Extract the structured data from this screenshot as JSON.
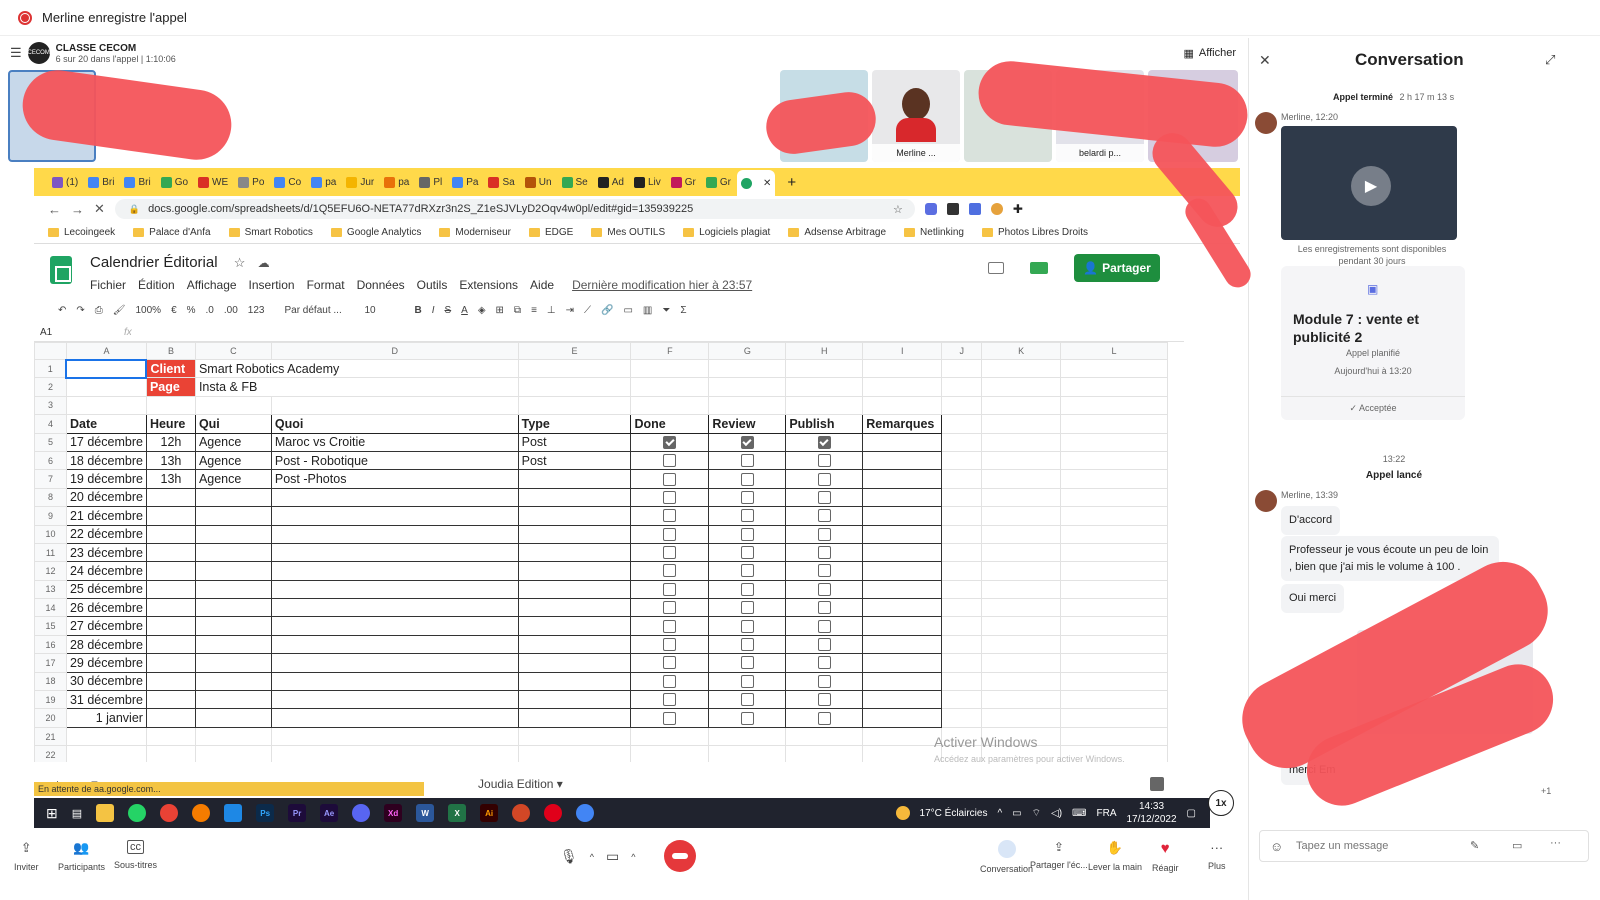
{
  "recording": {
    "text": "Merline enregistre l'appel"
  },
  "team": {
    "name": "CLASSE CECOM",
    "status": "6 sur 20 dans l'appel | 1:10:06",
    "show_label": "Afficher"
  },
  "participants": [
    {
      "name": "Merline ..."
    },
    {
      "name": "belardi p..."
    }
  ],
  "browser": {
    "tabs": [
      "(1)",
      "Bri",
      "Bri",
      "Go",
      "WE",
      "Po",
      "Co",
      "pa",
      "Jur",
      "pa",
      "Pl",
      "Pa",
      "Sa",
      "Un",
      "Se",
      "Ad",
      "Liv",
      "Gr",
      "Gr"
    ],
    "url": "docs.google.com/spreadsheets/d/1Q5EFU6O-NETA77dRXzr3n2S_Z1eSJVLyD2Oqv4w0pl/edit#gid=135939225",
    "bookmarks": [
      "Lecoingeek",
      "Palace d'Anfa",
      "Smart Robotics",
      "Google Analytics",
      "Moderniseur",
      "EDGE",
      "Mes OUTILS",
      "Logiciels plagiat",
      "Adsense Arbitrage",
      "Netlinking",
      "Photos Libres Droits"
    ]
  },
  "sheet": {
    "title": "Calendrier Éditorial",
    "menu": [
      "Fichier",
      "Édition",
      "Affichage",
      "Insertion",
      "Format",
      "Données",
      "Outils",
      "Extensions",
      "Aide"
    ],
    "last_modified": "Dernière modification hier à 23:57",
    "share_label": "Partager",
    "toolbar": {
      "zoom": "100%",
      "currency": "€",
      "percent": "%",
      "dec1": ".0",
      "dec2": ".00",
      "fmt": "123",
      "font": "Par défaut ...",
      "size": "10"
    },
    "cell_ref": "A1",
    "fx": "fx",
    "columns": [
      "A",
      "B",
      "C",
      "D",
      "E",
      "F",
      "G",
      "H",
      "I",
      "J",
      "K",
      "L"
    ],
    "client_label": "Client",
    "client_value": "Smart Robotics Academy",
    "page_label": "Page",
    "page_value": "Insta & FB",
    "headers": {
      "date": "Date",
      "heure": "Heure",
      "qui": "Qui",
      "quoi": "Quoi",
      "type": "Type",
      "done": "Done",
      "review": "Review",
      "publish": "Publish",
      "remarques": "Remarques"
    },
    "rows": [
      {
        "date": "17 décembre",
        "heure": "12h",
        "qui": "Agence",
        "quoi": "Maroc vs Croitie",
        "type": "Post",
        "done": true,
        "review": true,
        "publish": true
      },
      {
        "date": "18 décembre",
        "heure": "13h",
        "qui": "Agence",
        "quoi": "Post - Robotique",
        "type": "Post",
        "done": false,
        "review": false,
        "publish": false
      },
      {
        "date": "19 décembre",
        "heure": "13h",
        "qui": "Agence",
        "quoi": "Post -Photos",
        "type": "",
        "done": false,
        "review": false,
        "publish": false
      },
      {
        "date": "20 décembre",
        "heure": "",
        "qui": "",
        "quoi": "",
        "type": "",
        "done": false,
        "review": false,
        "publish": false
      },
      {
        "date": "21 décembre",
        "heure": "",
        "qui": "",
        "quoi": "",
        "type": "",
        "done": false,
        "review": false,
        "publish": false
      },
      {
        "date": "22 décembre",
        "heure": "",
        "qui": "",
        "quoi": "",
        "type": "",
        "done": false,
        "review": false,
        "publish": false
      },
      {
        "date": "23 décembre",
        "heure": "",
        "qui": "",
        "quoi": "",
        "type": "",
        "done": false,
        "review": false,
        "publish": false
      },
      {
        "date": "24 décembre",
        "heure": "",
        "qui": "",
        "quoi": "",
        "type": "",
        "done": false,
        "review": false,
        "publish": false
      },
      {
        "date": "25 décembre",
        "heure": "",
        "qui": "",
        "quoi": "",
        "type": "",
        "done": false,
        "review": false,
        "publish": false
      },
      {
        "date": "26 décembre",
        "heure": "",
        "qui": "",
        "quoi": "",
        "type": "",
        "done": false,
        "review": false,
        "publish": false
      },
      {
        "date": "27 décembre",
        "heure": "",
        "qui": "",
        "quoi": "",
        "type": "",
        "done": false,
        "review": false,
        "publish": false
      },
      {
        "date": "28 décembre",
        "heure": "",
        "qui": "",
        "quoi": "",
        "type": "",
        "done": false,
        "review": false,
        "publish": false
      },
      {
        "date": "29 décembre",
        "heure": "",
        "qui": "",
        "quoi": "",
        "type": "",
        "done": false,
        "review": false,
        "publish": false
      },
      {
        "date": "30 décembre",
        "heure": "",
        "qui": "",
        "quoi": "",
        "type": "",
        "done": false,
        "review": false,
        "publish": false
      },
      {
        "date": "31 décembre",
        "heure": "",
        "qui": "",
        "quoi": "",
        "type": "",
        "done": false,
        "review": false,
        "publish": false
      },
      {
        "date": "1 janvier",
        "heure": "",
        "qui": "",
        "quoi": "",
        "type": "",
        "done": false,
        "review": false,
        "publish": false
      }
    ],
    "sheet_tabs": [
      "Joudia Edition"
    ],
    "status": "En attente de aa.google.com...",
    "activate_title": "Activer Windows",
    "activate_sub": "Accédez aux paramètres pour activer Windows."
  },
  "taskbar": {
    "weather": "17°C  Éclaircies",
    "lang": "FRA",
    "time": "14:33",
    "date": "17/12/2022",
    "speed": "1x"
  },
  "call_controls": {
    "invite": "Inviter",
    "participants": "Participants",
    "subtitles": "Sous-titres",
    "conversation": "Conversation",
    "share": "Partager l'éc...",
    "raise_hand": "Lever la main",
    "react": "Réagir",
    "more": "Plus"
  },
  "conversation": {
    "title": "Conversation",
    "call_ended": "Appel terminé",
    "call_ended_duration": "2 h 17 m 13 s",
    "msg1_meta": "Merline, 12:20",
    "recordings_note": "Les enregistrements sont disponibles pendant 30 jours",
    "meeting_title": "Module 7 : vente et publicité 2",
    "meeting_status": "Appel planifié",
    "meeting_time": "Aujourd'hui à 13:20",
    "accepted": "Acceptée",
    "time_1322": "13:22",
    "call_started": "Appel lancé",
    "msg2_meta": "Merline, 13:39",
    "msg_daccord": "D'accord",
    "msg_prof": "Professeur  je vous écoute  un peu de  loin , bien que j'ai mis le volume  à  100  .",
    "msg_oui": "Oui merci",
    "msg_merci": "merci Em",
    "reactions_count": "+1",
    "compose_placeholder": "Tapez un message"
  }
}
